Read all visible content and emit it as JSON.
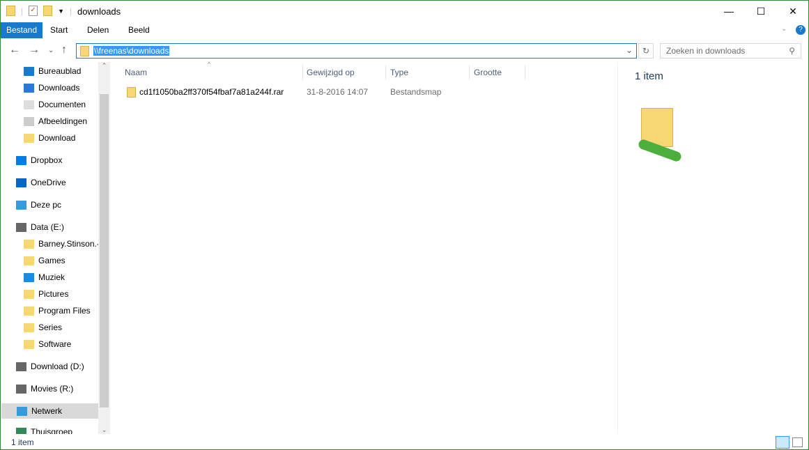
{
  "window": {
    "title": "downloads",
    "border_color": "#2b8a2b"
  },
  "window_controls": {
    "minimize": "—",
    "maximize": "☐",
    "close": "✕"
  },
  "ribbon": {
    "tabs": [
      "Bestand",
      "Start",
      "Delen",
      "Beeld"
    ],
    "accent": "#1979ca"
  },
  "address": {
    "path": "\\\\freenas\\downloads",
    "search_placeholder": "Zoeken in downloads"
  },
  "sidebar": {
    "items": [
      {
        "label": "Bureaublad",
        "icon": "desktop-icon",
        "pinned": true
      },
      {
        "label": "Downloads",
        "icon": "download-icon",
        "pinned": true
      },
      {
        "label": "Documenten",
        "icon": "documents-icon",
        "pinned": true
      },
      {
        "label": "Afbeeldingen",
        "icon": "pictures-icon",
        "pinned": true
      },
      {
        "label": "Download",
        "icon": "folder-icon",
        "pinned": true
      },
      {
        "label": "Dropbox",
        "icon": "dropbox-icon"
      },
      {
        "label": "OneDrive",
        "icon": "onedrive-icon"
      },
      {
        "label": "Deze pc",
        "icon": "pc-icon"
      },
      {
        "label": "Data (E:)",
        "icon": "drive-icon"
      },
      {
        "label": "Barney.Stinson.-",
        "icon": "folder-icon"
      },
      {
        "label": "Games",
        "icon": "folder-icon"
      },
      {
        "label": "Muziek",
        "icon": "music-icon"
      },
      {
        "label": "Pictures",
        "icon": "folder-icon"
      },
      {
        "label": "Program Files",
        "icon": "folder-icon"
      },
      {
        "label": "Series",
        "icon": "folder-icon"
      },
      {
        "label": "Software",
        "icon": "folder-icon"
      },
      {
        "label": "Download (D:)",
        "icon": "drive-icon"
      },
      {
        "label": "Movies (R:)",
        "icon": "drive-icon"
      },
      {
        "label": "Netwerk",
        "icon": "network-icon",
        "selected": true
      },
      {
        "label": "Thuisgroep",
        "icon": "homegroup-icon"
      }
    ]
  },
  "columns": [
    "Naam",
    "Gewijzigd op",
    "Type",
    "Grootte"
  ],
  "files": [
    {
      "name": "cd1f1050ba2ff370f54fbaf7a81a244f.rar",
      "modified": "31-8-2016 14:07",
      "type": "Bestandsmap",
      "size": ""
    }
  ],
  "details": {
    "count": "1 item"
  },
  "status": {
    "count": "1 item"
  }
}
